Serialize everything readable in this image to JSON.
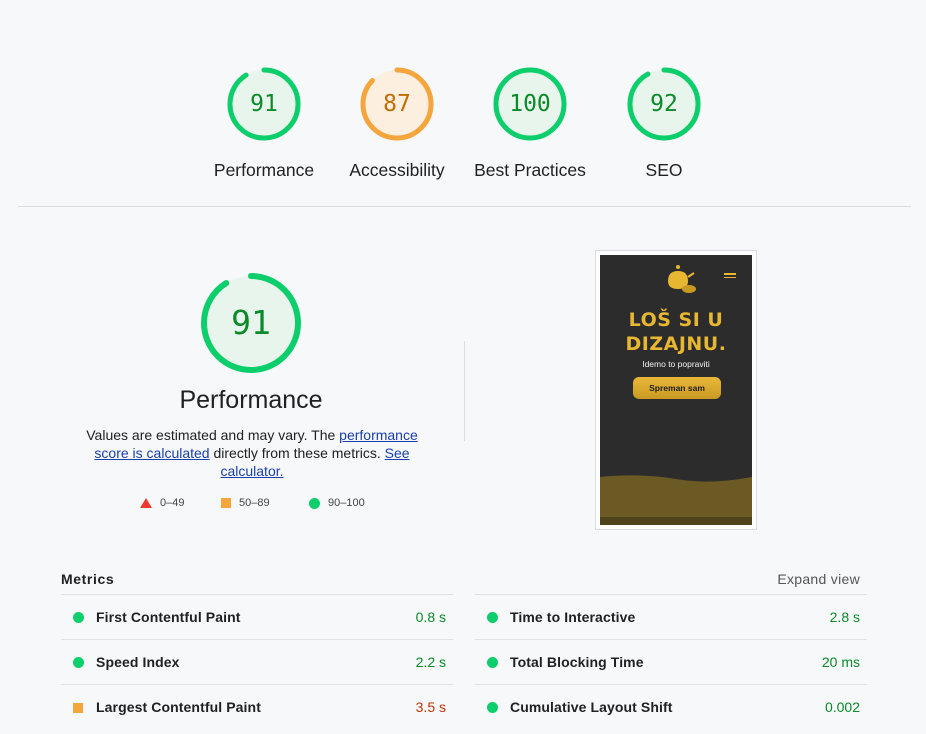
{
  "gauges": [
    {
      "score": 91,
      "label": "Performance",
      "color": "#0cce6b",
      "text_color": "#0a8a28",
      "fill": "#e8f5ec"
    },
    {
      "score": 87,
      "label": "Accessibility",
      "color": "#f4a53b",
      "text_color": "#c26d00",
      "fill": "#fcefe0"
    },
    {
      "score": 100,
      "label": "Best Practices",
      "color": "#0cce6b",
      "text_color": "#0a8a28",
      "fill": "#e8f5ec"
    },
    {
      "score": 92,
      "label": "SEO",
      "color": "#0cce6b",
      "text_color": "#0a8a28",
      "fill": "#e8f5ec"
    }
  ],
  "performance": {
    "score": 91,
    "title": "Performance",
    "desc_prefix": "Values are estimated and may vary. The ",
    "link1": "performance score is calculated",
    "desc_middle": " directly from these metrics. ",
    "link2": "See calculator."
  },
  "legend": {
    "fail": "0–49",
    "average": "50–89",
    "pass": "90–100"
  },
  "screenshot": {
    "hero_line1": "LOŠ SI U",
    "hero_line2": "DIZAJNU.",
    "subtitle": "Idemo to popraviti",
    "cta": "Spreman sam"
  },
  "metrics": {
    "title": "Metrics",
    "expand": "Expand view",
    "left": [
      {
        "name": "First Contentful Paint",
        "value": "0.8 s",
        "rating": "pass"
      },
      {
        "name": "Speed Index",
        "value": "2.2 s",
        "rating": "pass"
      },
      {
        "name": "Largest Contentful Paint",
        "value": "3.5 s",
        "rating": "average"
      }
    ],
    "right": [
      {
        "name": "Time to Interactive",
        "value": "2.8 s",
        "rating": "pass"
      },
      {
        "name": "Total Blocking Time",
        "value": "20 ms",
        "rating": "pass"
      },
      {
        "name": "Cumulative Layout Shift",
        "value": "0.002",
        "rating": "pass"
      }
    ]
  }
}
